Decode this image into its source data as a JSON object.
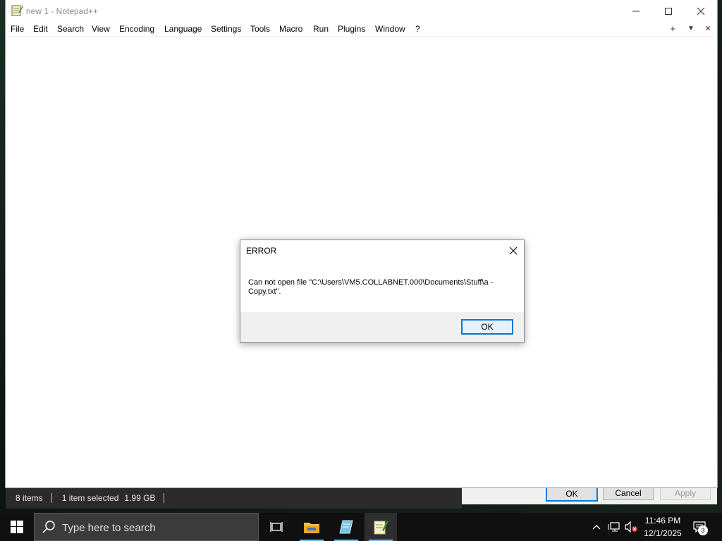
{
  "window": {
    "title": "new 1 - Notepad++",
    "minimize_label": "Minimize",
    "maximize_label": "Maximize",
    "close_label": "Close"
  },
  "menubar": {
    "items": [
      "File",
      "Edit",
      "Search",
      "View",
      "Encoding",
      "Language",
      "Settings",
      "Tools",
      "Macro",
      "Run",
      "Plugins",
      "Window",
      "?"
    ],
    "new_tab": "+",
    "tab_list": "▼",
    "close_tab": "✕"
  },
  "dialog": {
    "title": "ERROR",
    "message_line1": "Can not open file \"C:\\Users\\VM5.COLLABNET.000\\Documents\\Stuff\\a -",
    "message_line2": "Copy.txt\".",
    "ok_label": "OK"
  },
  "explorer_status": {
    "items": "8 items",
    "selected": "1 item selected",
    "size": "1.99 GB"
  },
  "properties_footer": {
    "ok": "OK",
    "cancel": "Cancel",
    "apply": "Apply"
  },
  "taskbar": {
    "search_placeholder": "Type here to search",
    "time": "11:46 PM",
    "date": "12/1/2025",
    "notification_count": "3"
  }
}
